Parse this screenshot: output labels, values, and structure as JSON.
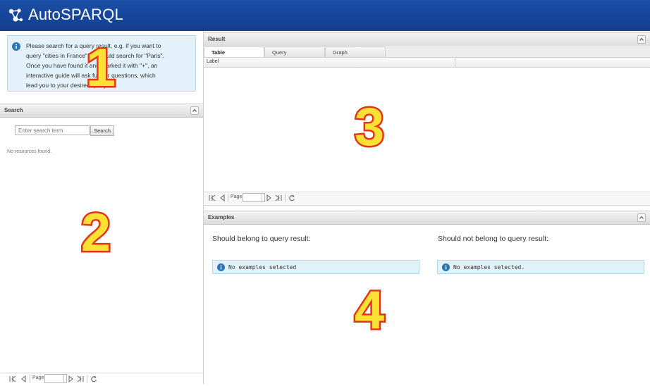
{
  "app": {
    "title": "AutoSPARQL"
  },
  "info": {
    "lines": [
      "Please search for a query result, e.g. if you want to",
      "query \"cities in France\" you could search for \"Paris\".",
      "Once you have found it and marked it with \"+\", an",
      "interactive guide will ask further questions, which",
      "lead you to your desired query."
    ]
  },
  "search_panel": {
    "title": "Search",
    "placeholder": "Enter search term",
    "button_label": "Search",
    "empty_message": "No resources found.",
    "pager_label": "Page"
  },
  "result_panel": {
    "title": "Result",
    "tabs": [
      {
        "label": "Table",
        "active": true
      },
      {
        "label": "Query",
        "active": false
      },
      {
        "label": "Graph",
        "active": false
      }
    ],
    "columns": [
      "Label"
    ],
    "pager_label": "Page"
  },
  "examples_panel": {
    "title": "Examples",
    "positive_heading": "Should belong to query result:",
    "negative_heading": "Should not belong to query result:",
    "positive_message": "No examples selected",
    "negative_message": "No examples selected."
  },
  "callouts": [
    "1",
    "2",
    "3",
    "4"
  ],
  "colors": {
    "topbar": "#1b4fa8",
    "info_bg": "#e3f1fa",
    "info_icon": "#2a74b8",
    "callout_fill": "#ffe135",
    "callout_stroke": "#e53515"
  }
}
